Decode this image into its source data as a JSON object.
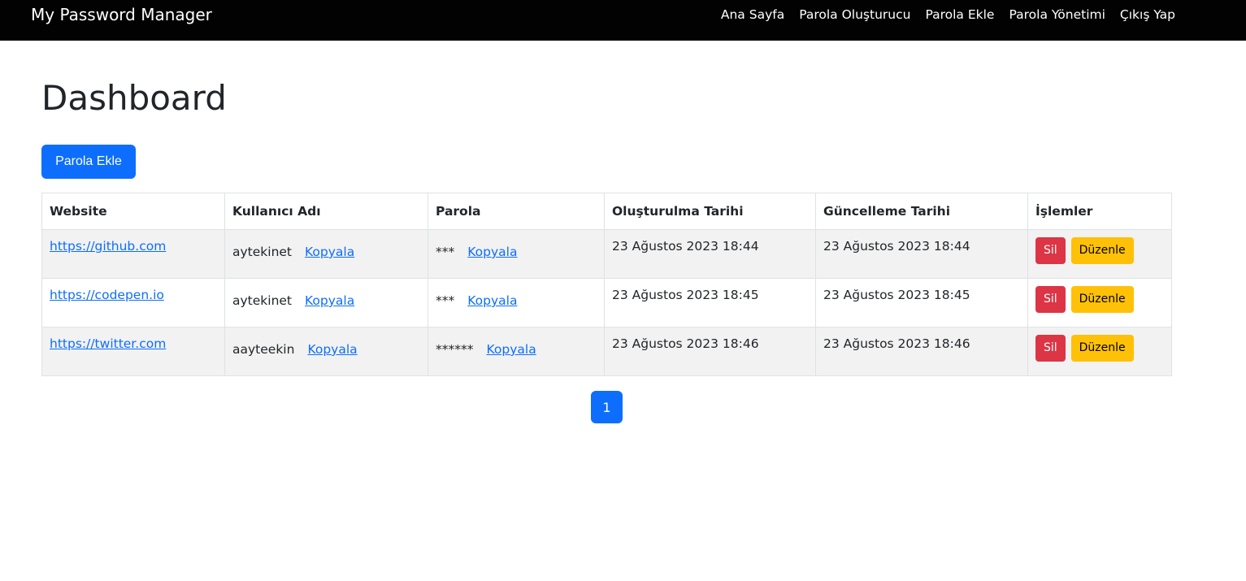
{
  "navbar": {
    "brand": "My Password Manager",
    "links": [
      "Ana Sayfa",
      "Parola Oluşturucu",
      "Parola Ekle",
      "Parola Yönetimi",
      "Çıkış Yap"
    ]
  },
  "page": {
    "title": "Dashboard",
    "add_button": "Parola Ekle"
  },
  "table": {
    "headers": [
      "Website",
      "Kullanıcı Adı",
      "Parola",
      "Oluşturulma Tarihi",
      "Güncelleme Tarihi",
      "İşlemler"
    ],
    "copy_label": "Kopyala",
    "delete_label": "Sil",
    "edit_label": "Düzenle",
    "rows": [
      {
        "website": "https://github.com",
        "username": "aytekinet",
        "password": "***",
        "created": "23 Ağustos 2023 18:44",
        "updated": "23 Ağustos 2023 18:44"
      },
      {
        "website": "https://codepen.io",
        "username": "aytekinet",
        "password": "***",
        "created": "23 Ağustos 2023 18:45",
        "updated": "23 Ağustos 2023 18:45"
      },
      {
        "website": "https://twitter.com",
        "username": "aayteekin",
        "password": "******",
        "created": "23 Ağustos 2023 18:46",
        "updated": "23 Ağustos 2023 18:46"
      }
    ]
  },
  "pagination": {
    "current_page": "1"
  },
  "colors": {
    "navbar_bg": "#020202",
    "primary": "#0d6efd",
    "danger": "#dc3545",
    "warning": "#ffc107"
  }
}
